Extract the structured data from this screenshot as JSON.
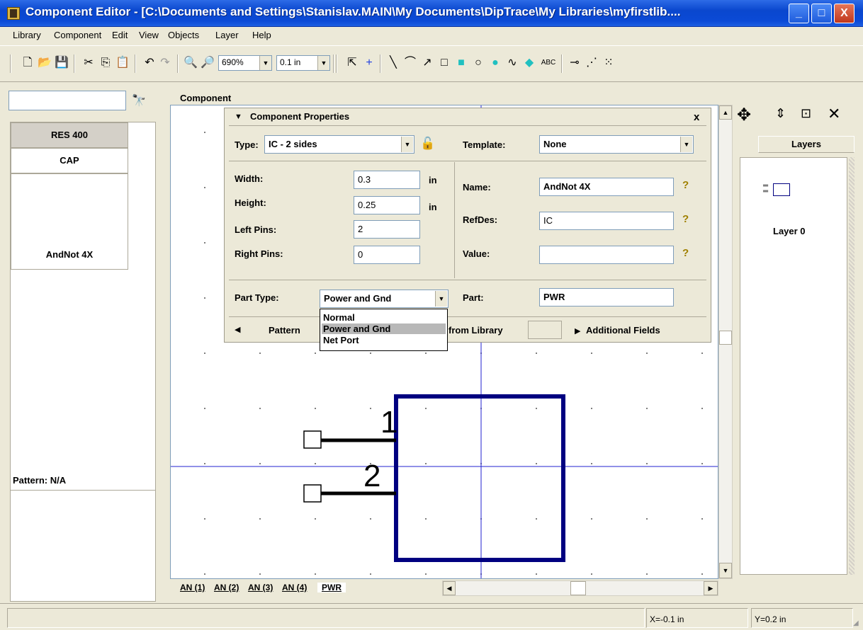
{
  "window": {
    "title": "Component Editor - [C:\\Documents and Settings\\Stanislav.MAIN\\My Documents\\DipTrace\\My Libraries\\myfirstlib....",
    "minimize": "_",
    "maximize": "□",
    "close": "X"
  },
  "menu": [
    "Library",
    "Component",
    "Edit",
    "View",
    "Objects",
    "Layer",
    "Help"
  ],
  "toolbar": {
    "zoom_value": "690%",
    "grid_value": "0.1 in",
    "text_tool": "ABC"
  },
  "library": {
    "search_value": "",
    "components": [
      "RES 400",
      "CAP",
      "AndNot 4X"
    ],
    "selected_index": 0,
    "pattern_label": "Pattern: N/A"
  },
  "canvas": {
    "group_label": "Component",
    "pin_numbers": [
      "1",
      "2"
    ],
    "tabs": [
      "AN (1)",
      "AN (2)",
      "AN (3)",
      "AN (4)",
      "PWR"
    ],
    "active_tab": "PWR",
    "part_color": "#000080"
  },
  "properties": {
    "header": "Component Properties",
    "close": "x",
    "type_label": "Type:",
    "type_value": "IC - 2 sides",
    "template_label": "Template:",
    "template_value": "None",
    "width_label": "Width:",
    "width_value": "0.3",
    "height_label": "Height:",
    "height_value": "0.25",
    "unit": "in",
    "left_pins_label": "Left Pins:",
    "left_pins_value": "2",
    "right_pins_label": "Right Pins:",
    "right_pins_value": "0",
    "name_label": "Name:",
    "name_value": "AndNot 4X",
    "refdes_label": "RefDes:",
    "refdes_value": "IC",
    "value_label": "Value:",
    "value_value": "",
    "part_type_label": "Part Type:",
    "part_type_value": "Power and Gnd",
    "part_label": "Part:",
    "part_value": "PWR",
    "part_type_options": [
      "Normal",
      "Power and Gnd",
      "Net Port"
    ],
    "pattern_link": "Pattern",
    "from_library": "from Library",
    "additional_fields": "Additional Fields"
  },
  "layers": {
    "header": "Layers",
    "items": [
      "Layer 0"
    ]
  },
  "status": {
    "x": "X=-0.1 in",
    "y": "Y=0.2 in"
  }
}
